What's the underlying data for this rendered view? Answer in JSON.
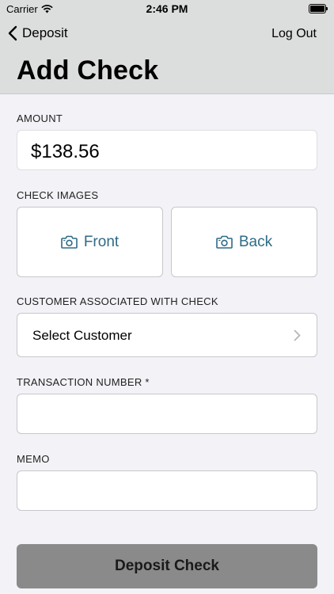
{
  "status_bar": {
    "carrier": "Carrier",
    "time": "2:46 PM",
    "icons": [
      "wifi-icon",
      "battery-icon"
    ]
  },
  "nav": {
    "back_label": "Deposit",
    "logout_label": "Log Out",
    "title": "Add Check"
  },
  "form": {
    "amount_label": "AMOUNT",
    "amount_value": "$138.56",
    "check_images_label": "CHECK IMAGES",
    "front_label": "Front",
    "back_label": "Back",
    "customer_label": "CUSTOMER ASSOCIATED WITH CHECK",
    "customer_value": "Select Customer",
    "transaction_label": "TRANSACTION NUMBER *",
    "transaction_value": "",
    "memo_label": "MEMO",
    "memo_value": "",
    "submit_label": "Deposit Check"
  },
  "colors": {
    "header_bg": "#dcdedd",
    "page_bg": "#f2f2f7",
    "accent": "#2e6b86",
    "button_disabled": "#8a8a8a"
  }
}
